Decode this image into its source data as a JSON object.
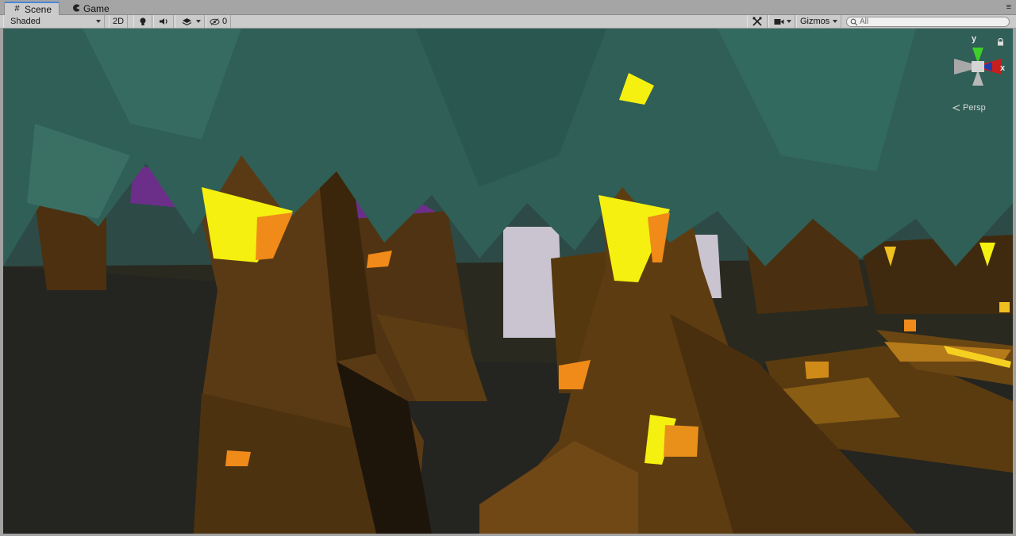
{
  "tabs": [
    {
      "label": "Scene",
      "icon": "hash-icon",
      "active": true
    },
    {
      "label": "Game",
      "icon": "pacman-icon",
      "active": false
    }
  ],
  "toolbar": {
    "shading_mode": "Shaded",
    "mode_2d": "2D",
    "lighting_icon": "lightbulb-icon",
    "audio_icon": "speaker-icon",
    "effects_icon": "layers-icon",
    "hidden_count": "0",
    "hidden_icon": "eye-slash-icon",
    "tools_icon": "tools-icon",
    "camera_icon": "camera-icon",
    "gizmos_label": "Gizmos",
    "search_placeholder": "All"
  },
  "gizmo": {
    "y_label": "y",
    "x_label": "x",
    "projection": "Persp"
  },
  "colors": {
    "accent": "#4a87d4",
    "canopy": "#2e5e55",
    "trunk": "#5a3a14",
    "glow_yellow": "#f5f010",
    "glow_orange": "#f08a18",
    "ground": "#2a2a26",
    "purple": "#6b2f8a",
    "gizmo_y": "#3ecf2a",
    "gizmo_x": "#c81e1e"
  }
}
